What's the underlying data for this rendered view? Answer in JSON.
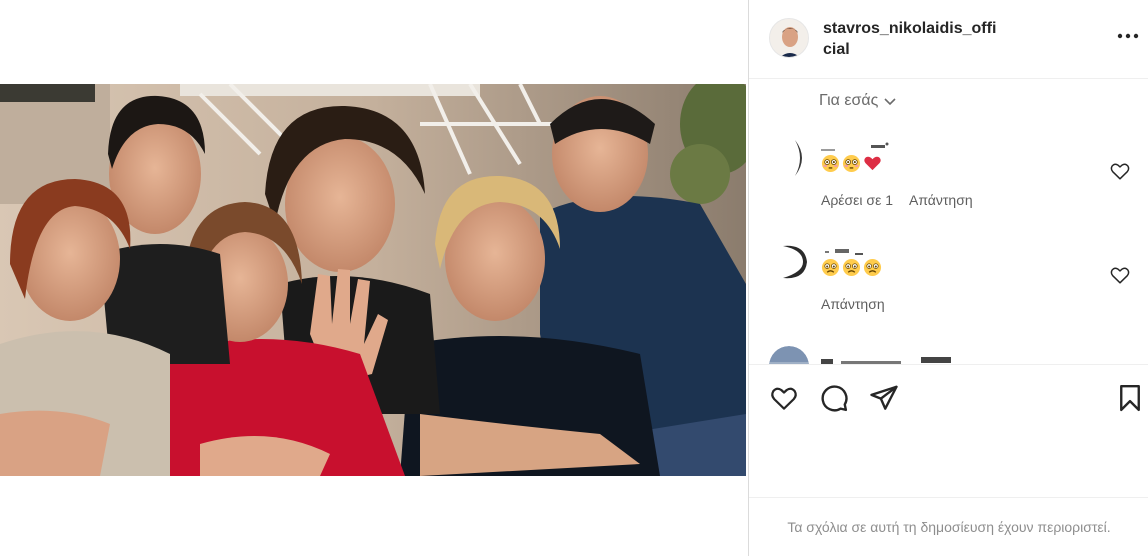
{
  "post": {
    "username": "stavros_nikolaidis_official"
  },
  "comments_section": {
    "for_you_label": "Για εσάς",
    "items": [
      {
        "emojis": [
          "flushed-face",
          "flushed-face",
          "red-heart"
        ],
        "likes_label": "Αρέσει σε 1",
        "reply_label": "Απάντηση"
      },
      {
        "emojis": [
          "sad-face",
          "sad-face",
          "sad-face"
        ],
        "reply_label": "Απάντηση"
      }
    ]
  },
  "actions": {
    "icons": [
      "heart-icon",
      "comment-icon",
      "share-icon",
      "bookmark-icon"
    ]
  },
  "footer": {
    "comments_limited_text": "Τα σχόλια σε αυτή τη δημοσίευση έχουν περιοριστεί."
  },
  "colors": {
    "border": "#dbdbdb",
    "text_primary": "#262626",
    "text_secondary": "#8e8e8e",
    "heart_red": "#ed4956"
  }
}
